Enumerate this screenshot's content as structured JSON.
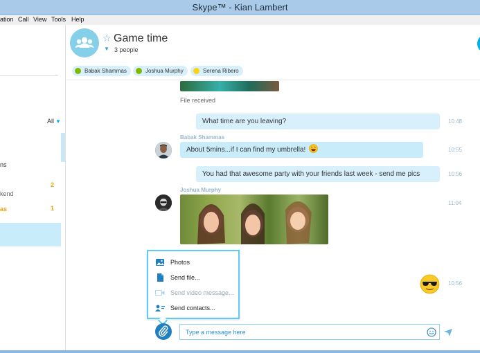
{
  "window": {
    "title": "Skype™ - Kian Lambert"
  },
  "menu": [
    "ation",
    "Call",
    "View",
    "Tools",
    "Help"
  ],
  "sidebar": {
    "filter_label": "All",
    "snippets": [
      {
        "text": "ns",
        "color": "#333333"
      },
      {
        "text": "kend",
        "color": "#666666"
      },
      {
        "text": "as",
        "color": "#f0a30a"
      }
    ],
    "counts": [
      "2",
      "1"
    ]
  },
  "conversation": {
    "title": "Game time",
    "people_count": "3 people",
    "participants": [
      {
        "name": "Babak Shammas",
        "status": "online",
        "status_color": "#7fba00"
      },
      {
        "name": "Joshua Murphy",
        "status": "online",
        "status_color": "#7fba00"
      },
      {
        "name": "Serena Ribero",
        "status": "away",
        "status_color": "#fcd116"
      }
    ]
  },
  "messages": {
    "file_received": "File received",
    "m1": {
      "text": "What time are you leaving?",
      "time": "10:48"
    },
    "m2": {
      "sender": "Babak Shammas",
      "text": "About 5mins...if I can find my umbrella!",
      "time": "10:55"
    },
    "m3": {
      "text": "You had that awesome party with your friends last week - send me pics",
      "time": "10:56"
    },
    "m4": {
      "sender": "Joshua Murphy",
      "time": "11:04"
    },
    "m5": {
      "time": "10:56"
    }
  },
  "attach_menu": {
    "items": [
      {
        "label": "Photos",
        "enabled": true,
        "icon": "photos-icon"
      },
      {
        "label": "Send file...",
        "enabled": true,
        "icon": "file-icon"
      },
      {
        "label": "Send video message...",
        "enabled": false,
        "icon": "video-message-icon"
      },
      {
        "label": "Send contacts...",
        "enabled": true,
        "icon": "contacts-icon"
      }
    ]
  },
  "composer": {
    "placeholder": "Type a message here"
  },
  "colors": {
    "accent": "#00aff0",
    "bubble": "#d7f0fb",
    "titlebar": "#a9cbe9"
  }
}
